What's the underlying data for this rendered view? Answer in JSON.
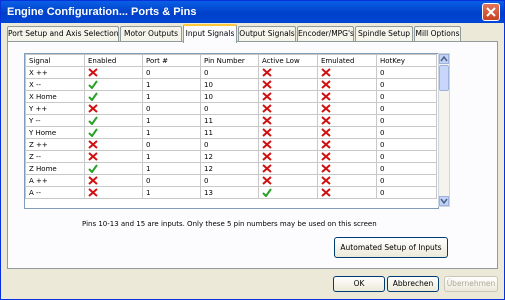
{
  "window": {
    "title": "Engine Configuration... Ports & Pins"
  },
  "tabs": [
    {
      "label": "Port Setup and Axis Selection"
    },
    {
      "label": "Motor Outputs"
    },
    {
      "label": "Input Signals"
    },
    {
      "label": "Output Signals"
    },
    {
      "label": "Encoder/MPG's"
    },
    {
      "label": "Spindle Setup"
    },
    {
      "label": "Mill Options"
    }
  ],
  "table": {
    "headers": [
      "Signal",
      "Enabled",
      "Port #",
      "Pin Number",
      "Active Low",
      "Emulated",
      "HotKey"
    ],
    "rows": [
      {
        "signal": "X ++",
        "enabled": false,
        "port": "0",
        "pin": "0",
        "active_low": false,
        "emulated": false,
        "hotkey": "0"
      },
      {
        "signal": "X --",
        "enabled": true,
        "port": "1",
        "pin": "10",
        "active_low": false,
        "emulated": false,
        "hotkey": "0"
      },
      {
        "signal": "X Home",
        "enabled": true,
        "port": "1",
        "pin": "10",
        "active_low": false,
        "emulated": false,
        "hotkey": "0"
      },
      {
        "signal": "Y ++",
        "enabled": false,
        "port": "0",
        "pin": "0",
        "active_low": false,
        "emulated": false,
        "hotkey": "0"
      },
      {
        "signal": "Y --",
        "enabled": true,
        "port": "1",
        "pin": "11",
        "active_low": false,
        "emulated": false,
        "hotkey": "0"
      },
      {
        "signal": "Y Home",
        "enabled": true,
        "port": "1",
        "pin": "11",
        "active_low": false,
        "emulated": false,
        "hotkey": "0"
      },
      {
        "signal": "Z ++",
        "enabled": false,
        "port": "0",
        "pin": "0",
        "active_low": false,
        "emulated": false,
        "hotkey": "0"
      },
      {
        "signal": "Z --",
        "enabled": false,
        "port": "1",
        "pin": "12",
        "active_low": false,
        "emulated": false,
        "hotkey": "0"
      },
      {
        "signal": "Z Home",
        "enabled": true,
        "port": "1",
        "pin": "12",
        "active_low": false,
        "emulated": false,
        "hotkey": "0"
      },
      {
        "signal": "A ++",
        "enabled": false,
        "port": "0",
        "pin": "0",
        "active_low": false,
        "emulated": false,
        "hotkey": "0"
      },
      {
        "signal": "A --",
        "enabled": false,
        "port": "1",
        "pin": "13",
        "active_low": true,
        "emulated": false,
        "hotkey": "0"
      }
    ]
  },
  "note": "Pins 10-13 and 15 are inputs. Only these 5 pin numbers may be used on this screen",
  "buttons": {
    "automated_setup": "Automated Setup of Inputs",
    "ok": "OK",
    "cancel": "Abbrechen",
    "apply": "Übernehmen"
  },
  "colors": {
    "titlebar": "#0a5fe6",
    "check": "#2aa02a",
    "cross": "#d01010"
  }
}
